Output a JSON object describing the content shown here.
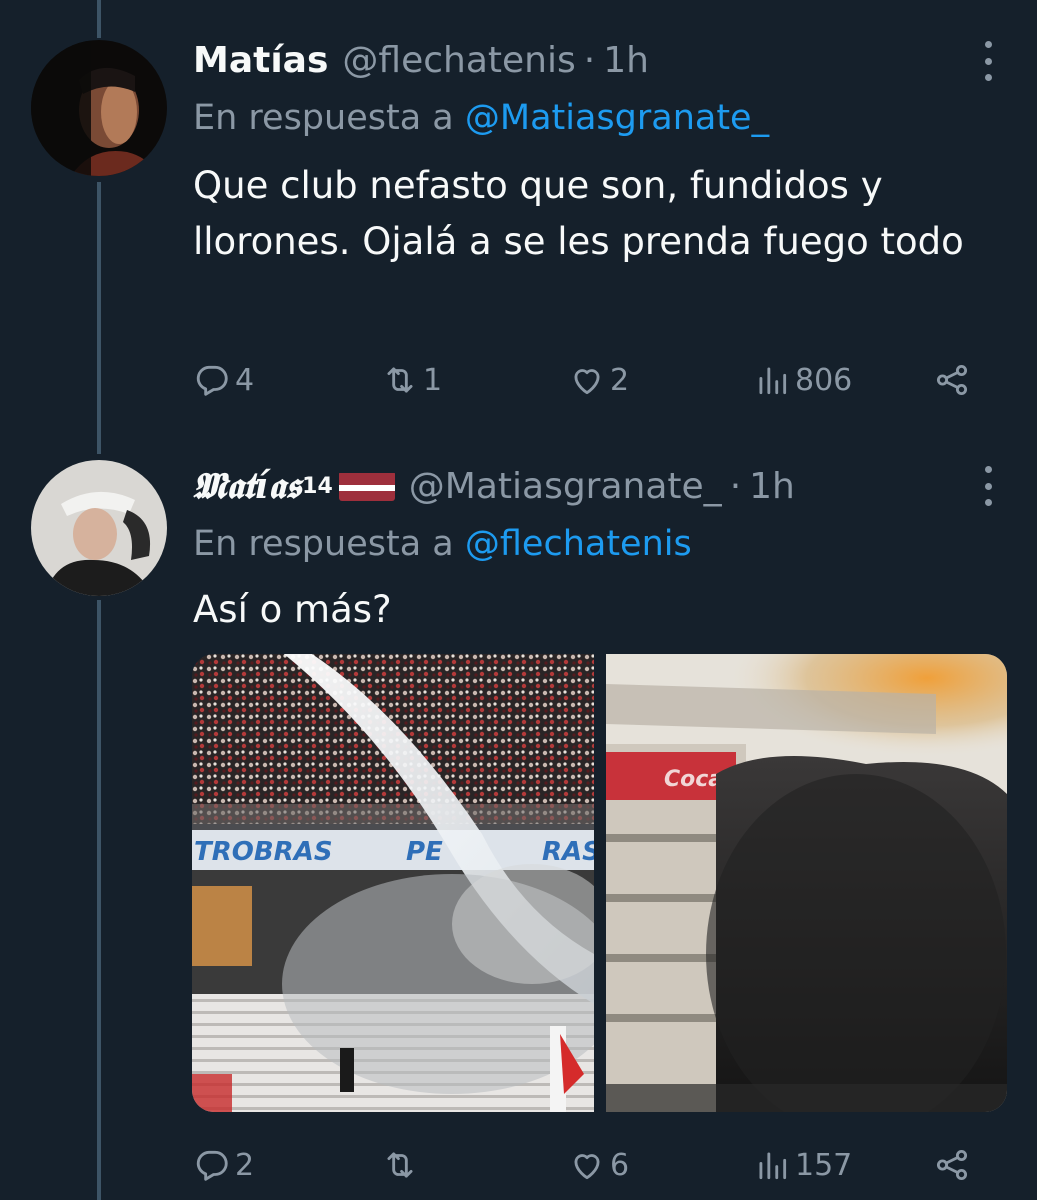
{
  "tweets": [
    {
      "display_name": "Matías",
      "handle": "@flechatenis",
      "separator": "·",
      "time": "1h",
      "reply_prefix": "En respuesta a",
      "reply_mention": "@Matiasgranate_",
      "text": "Que club nefasto que son, fundidos y llorones. Ojalá a se les prenda fuego todo",
      "stats": {
        "replies": "4",
        "retweets": "1",
        "likes": "2",
        "views": "806"
      }
    },
    {
      "display_name": "𝕸𝖆𝖙í𝖆𝖘",
      "name_superscript": "14",
      "handle": "@Matiasgranate_",
      "separator": "·",
      "time": "1h",
      "reply_prefix": "En respuesta a",
      "reply_mention": "@flechatenis",
      "text": "Así o más?",
      "stats": {
        "replies": "2",
        "retweets": "",
        "likes": "6",
        "views": "157"
      }
    }
  ],
  "media": [
    {
      "text": "TROBRAS"
    },
    {
      "text": "PE"
    },
    {
      "text": "RAS"
    },
    {
      "text": "Coca"
    }
  ],
  "colors": {
    "background": "#15202b",
    "text_primary": "#f7f9f9",
    "text_secondary": "#8b98a5",
    "accent": "#1d9bf0",
    "thread_line": "#3d5466"
  },
  "icons": [
    "reply-icon",
    "retweet-icon",
    "like-icon",
    "views-icon",
    "share-icon",
    "more-icon"
  ]
}
